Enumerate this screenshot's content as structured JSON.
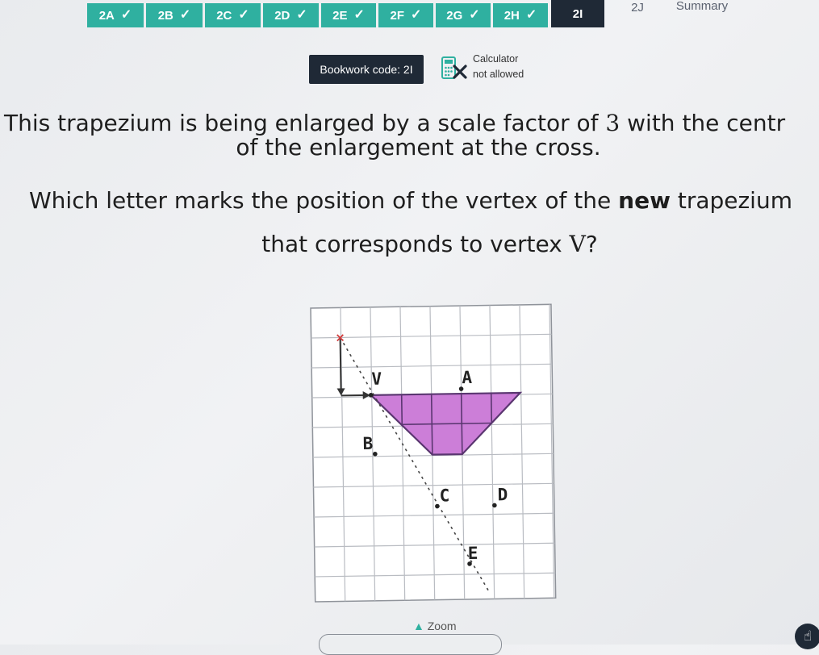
{
  "tabs": [
    {
      "label": "2A",
      "state": "done"
    },
    {
      "label": "2B",
      "state": "done"
    },
    {
      "label": "2C",
      "state": "done"
    },
    {
      "label": "2D",
      "state": "done"
    },
    {
      "label": "2E",
      "state": "done"
    },
    {
      "label": "2F",
      "state": "done"
    },
    {
      "label": "2G",
      "state": "done"
    },
    {
      "label": "2H",
      "state": "done"
    },
    {
      "label": "2I",
      "state": "current"
    },
    {
      "label": "2J",
      "state": "pending"
    },
    {
      "label": "Summary",
      "state": "pending"
    }
  ],
  "tick_symbol": "✓",
  "bookwork": {
    "label": "Bookwork code: 2I"
  },
  "calculator": {
    "line1": "Calculator",
    "line2": "not allowed",
    "icon": "calculator-crossed-icon"
  },
  "question": {
    "line1_a": "This trapezium is being enlarged by a scale factor of ",
    "line1_factor": "3",
    "line1_b": " with the centr",
    "line2": "of the enlargement at the cross.",
    "line3_a": "Which letter marks the position of the vertex of the ",
    "line3_bold": "new",
    "line3_b": " trapezium",
    "line4_a": "that corresponds to vertex ",
    "line4_vertex": "V",
    "line4_b": "?"
  },
  "diagram": {
    "point_labels": [
      "V",
      "A",
      "B",
      "C",
      "D",
      "E"
    ],
    "centre_marker": "×",
    "colors": {
      "trapezium_fill": "#cc7ed8",
      "trapezium_stroke": "#5a3670",
      "grid_line": "#b9bcc2",
      "grid_bg": "#ffffff",
      "accent": "#2fb0a0",
      "centre_mark": "#d23a3a"
    }
  },
  "zoom": {
    "label": "Zoom",
    "icon": "zoom-icon"
  },
  "help": {
    "icon": "hand-pointer-icon"
  }
}
